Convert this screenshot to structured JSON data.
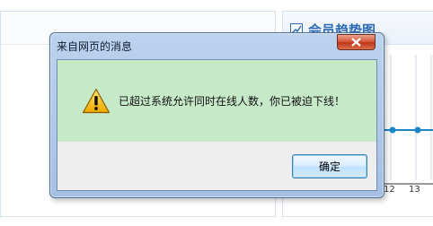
{
  "background": {
    "right_panel_title": "会员趋势图",
    "x_ticks": [
      "12",
      "13"
    ]
  },
  "dialog": {
    "title": "来自网页的消息",
    "message": "已超过系统允许同时在线人数，你已被迫下线！",
    "ok_label": "确定",
    "icon": "warning-icon",
    "close_icon": "close-icon"
  },
  "colors": {
    "message_bg": "#c6e9c8",
    "dialog_frame": "#a4c0e4",
    "close_button": "#c0381a",
    "chart_line": "#1a86c8",
    "title_blue": "#2e6cb8"
  }
}
